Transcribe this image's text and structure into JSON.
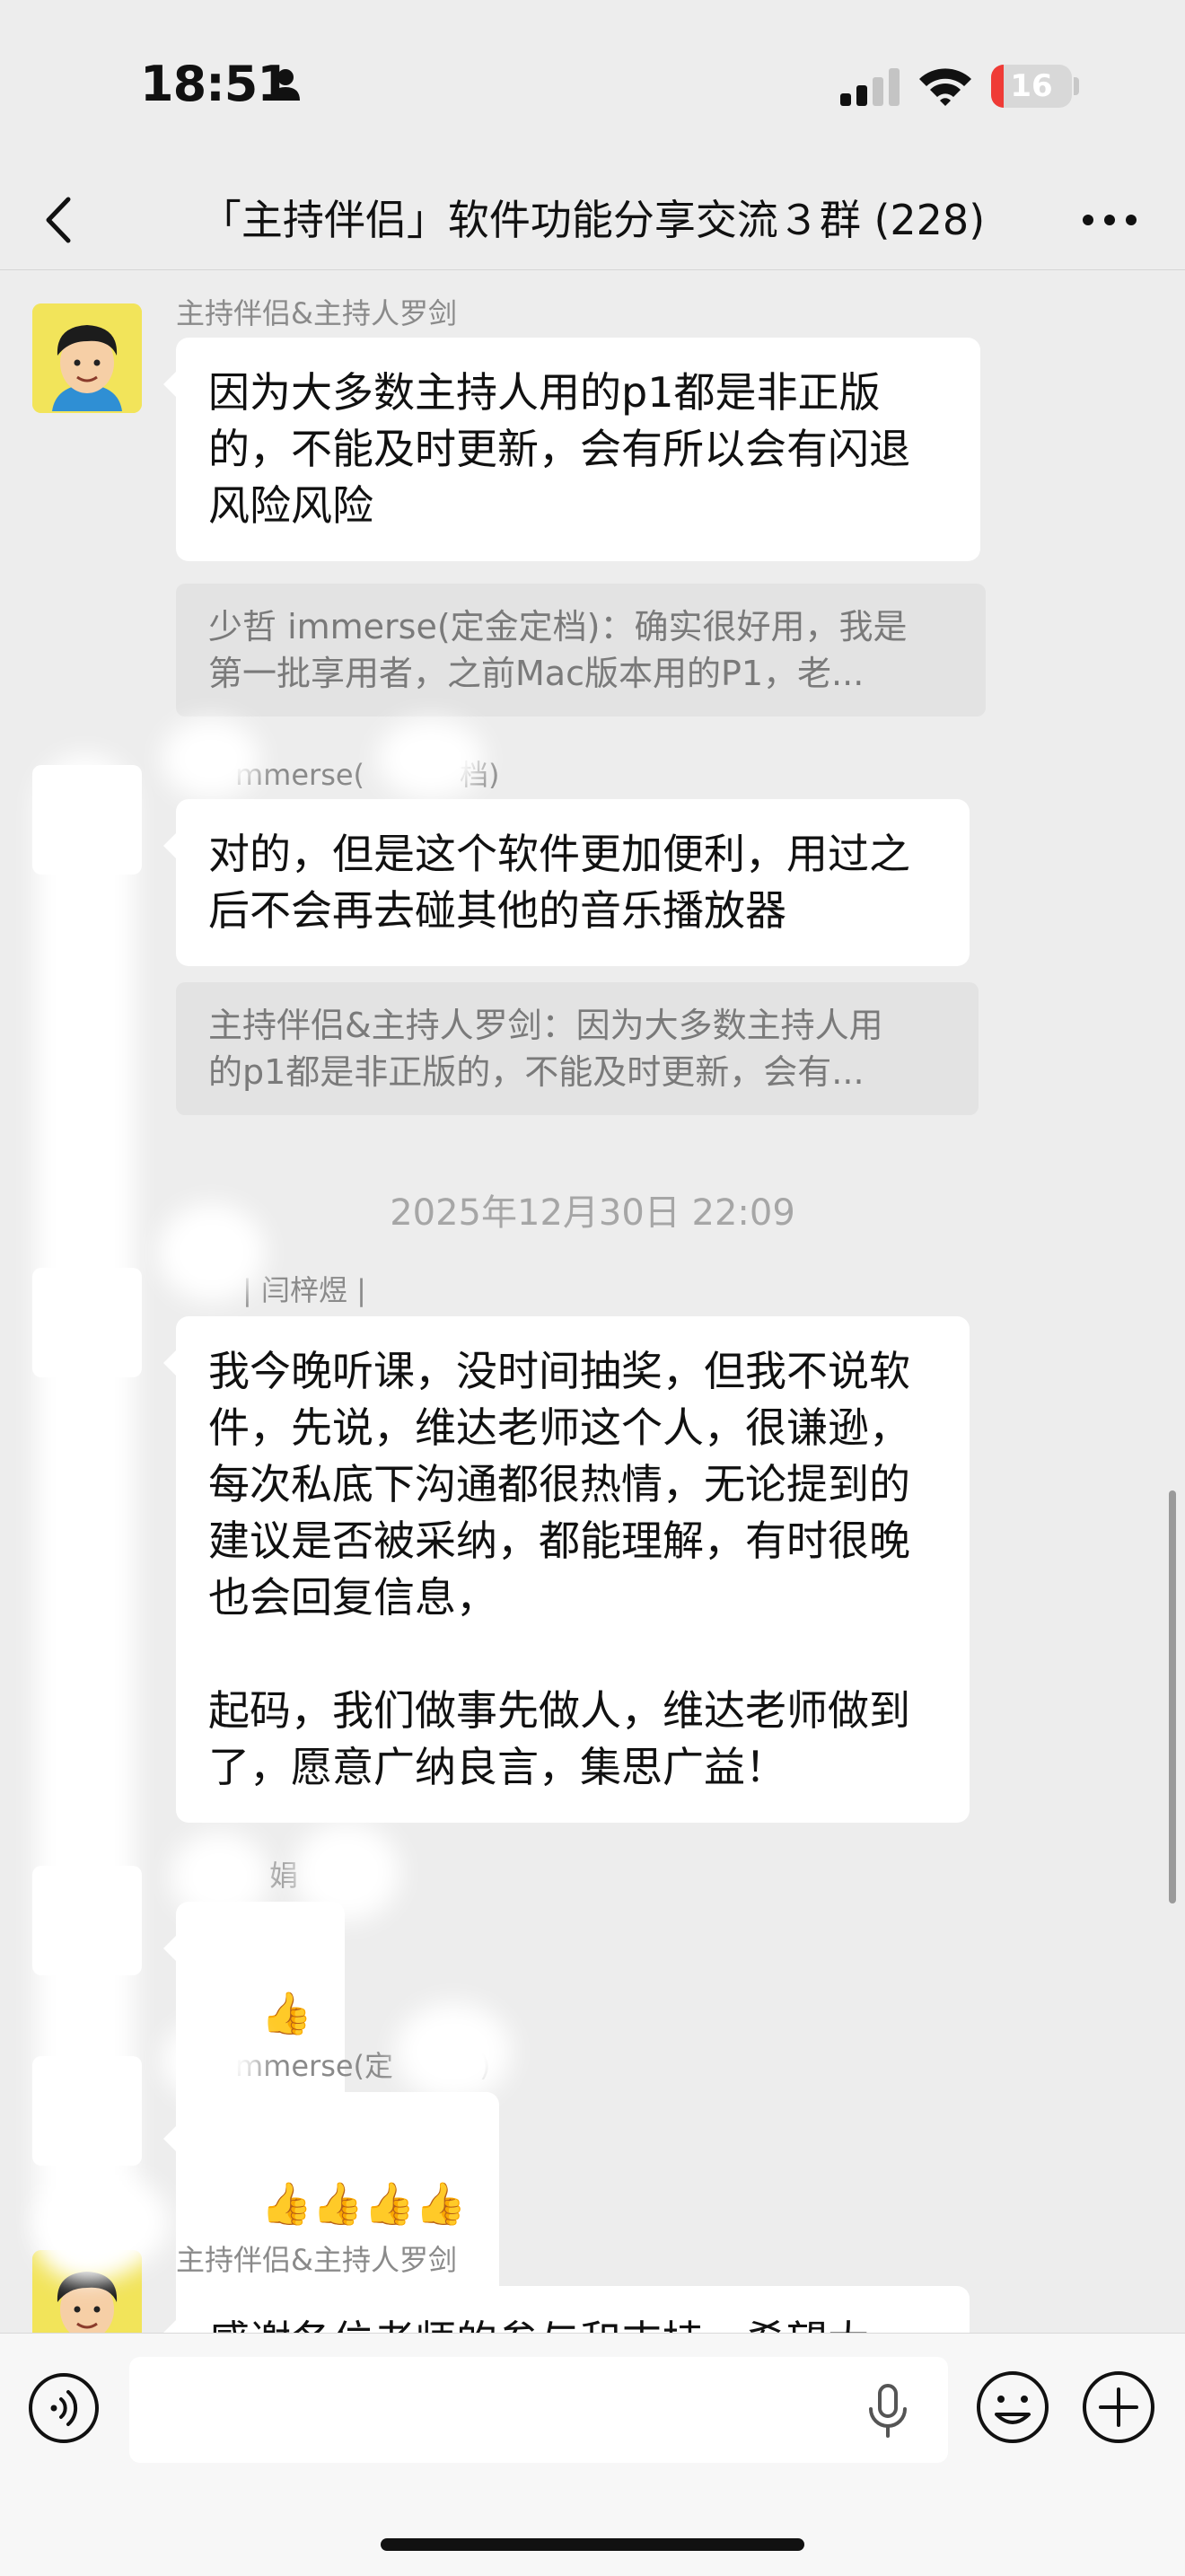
{
  "status_bar": {
    "time": "18:51",
    "battery": "16",
    "battery_level": 0.16
  },
  "nav": {
    "title": "「主持伴侣」软件功能分享交流３群 (228)"
  },
  "messages": [
    {
      "sender": "主持伴侣&主持人罗剑",
      "text": "因为大多数主持人用的p1都是非正版的，不能及时更新，会有所以会有闪退风险风险",
      "quote": [
        "少哲 immerse(定金定档)：确实很好用，我是",
        "第一批享用者，之前Mac版本用的P1，老..."
      ]
    },
    {
      "sender": "mmerse(",
      "sender_tail": "档)",
      "text": "对的，但是这个软件更加便利，用过之后不会再去碰其他的音乐播放器",
      "quote": [
        "主持伴侣&主持人罗剑：因为大多数主持人用",
        "的p1都是非正版的，不能及时更新，会有..."
      ]
    },
    {
      "timestamp": "2025年12月30日 22:09"
    },
    {
      "sender": "| 闫梓煜 |",
      "text": "我今晚听课，没时间抽奖，但我不说软件，先说，维达老师这个人，很谦逊，每次私底下沟通都很热情，无论提到的建议是否被采纳，都能理解，有时很晚也会回复信息，\n\n起码，我们做事先做人，维达老师做到了，愿意广纳良言，集思广益！"
    },
    {
      "sender": "娟",
      "text": "👍"
    },
    {
      "sender": "mmerse(定",
      "sender_tail": ")",
      "text": "👍👍👍👍"
    },
    {
      "sender": "主持伴侣&主持人罗剑",
      "text": "感谢各位老师的参与和支持，希望大"
    }
  ],
  "input": {
    "placeholder": ""
  }
}
